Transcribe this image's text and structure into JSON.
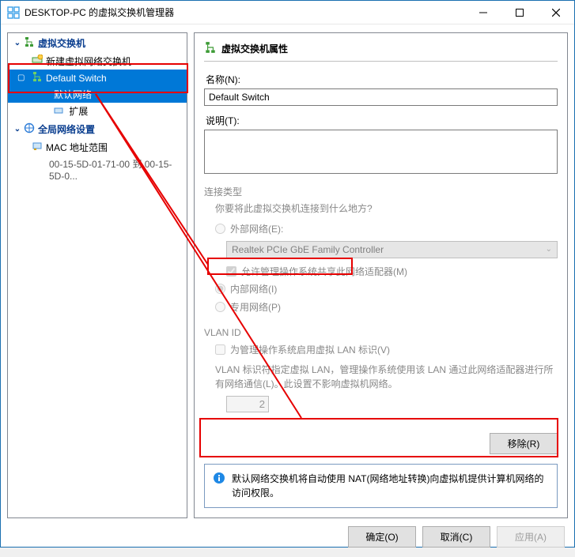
{
  "window": {
    "title": "DESKTOP-PC 的虚拟交换机管理器"
  },
  "tree": {
    "section1": "虚拟交换机",
    "new_switch": "新建虚拟网络交换机",
    "default_switch": "Default Switch",
    "default_switch_sub": "默认网络",
    "ext": "扩展",
    "section2": "全局网络设置",
    "mac_range": "MAC 地址范围",
    "mac_range_val": "00-15-5D-01-71-00 到 00-15-5D-0..."
  },
  "props": {
    "header": "虚拟交换机属性",
    "name_label": "名称(N):",
    "name_value": "Default Switch",
    "desc_label": "说明(T):",
    "conn_type": "连接类型",
    "conn_prompt": "你要将此虚拟交换机连接到什么地方?",
    "radio_ext": "外部网络(E):",
    "nic": "Realtek PCIe GbE Family Controller",
    "allow_mgmt": "允许管理操作系统共享此网络适配器(M)",
    "radio_int": "内部网络(I)",
    "radio_priv": "专用网络(P)",
    "vlan_title": "VLAN ID",
    "vlan_check": "为管理操作系统启用虚拟 LAN 标识(V)",
    "vlan_note": "VLAN 标识符指定虚拟 LAN，管理操作系统使用该 LAN 通过此网络适配器进行所有网络通信(L)。此设置不影响虚拟机网络。",
    "vlan_id": "2",
    "remove": "移除(R)",
    "info": "默认网络交换机将自动使用 NAT(网络地址转换)向虚拟机提供计算机网络的访问权限。"
  },
  "footer": {
    "ok": "确定(O)",
    "cancel": "取消(C)",
    "apply": "应用(A)"
  }
}
